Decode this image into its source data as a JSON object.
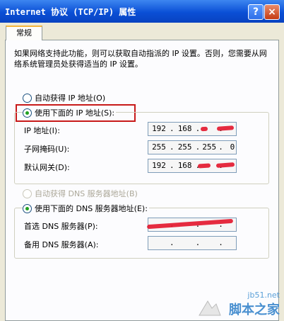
{
  "window": {
    "title": "Internet 协议 (TCP/IP) 属性",
    "help": "?",
    "close": "×"
  },
  "tab": {
    "label": "常规"
  },
  "description": "如果网络支持此功能，则可以获取自动指派的 IP 设置。否则，您需要从网络系统管理员处获得适当的 IP 设置。",
  "ip_section": {
    "auto_label": "自动获得 IP 地址(O)",
    "manual_label": "使用下面的 IP 地址(S):",
    "selected": "manual",
    "fields": [
      {
        "label": "IP 地址(I):",
        "octets": [
          "192",
          "168",
          "",
          ""
        ]
      },
      {
        "label": "子网掩码(U):",
        "octets": [
          "255",
          "255",
          "255",
          "0"
        ]
      },
      {
        "label": "默认网关(D):",
        "octets": [
          "192",
          "168",
          "",
          ""
        ]
      }
    ]
  },
  "dns_section": {
    "auto_label": "自动获得 DNS 服务器地址(B)",
    "manual_label": "使用下面的 DNS 服务器地址(E):",
    "auto_disabled": true,
    "fields": [
      {
        "label": "首选 DNS 服务器(P):",
        "octets": [
          "",
          "",
          "",
          ""
        ]
      },
      {
        "label": "备用 DNS 服务器(A):",
        "octets": [
          "",
          "",
          "",
          ""
        ]
      }
    ]
  },
  "watermark": {
    "site": "jb51.net",
    "name": "脚本之家"
  },
  "colors": {
    "title_bar": "#0a4fd6",
    "highlight_box": "#c81a1a",
    "scribble": "#e3152b"
  }
}
